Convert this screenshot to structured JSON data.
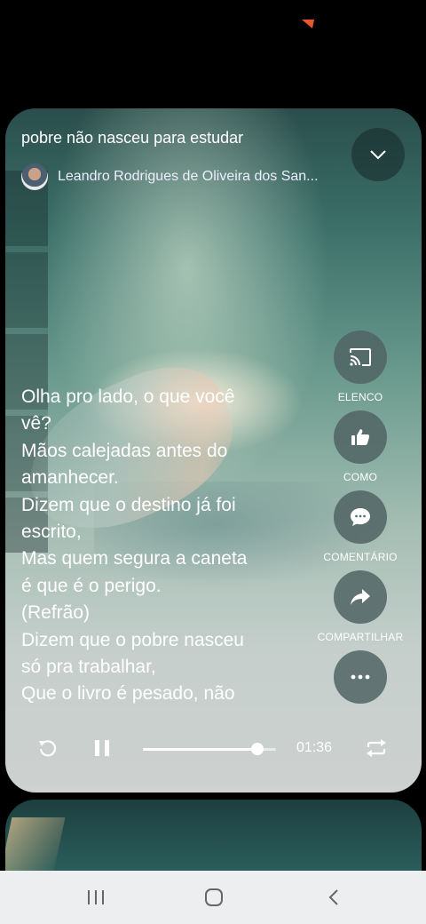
{
  "app": {
    "song_title": "pobre não nasceu para estudar",
    "author_name": "Leandro Rodrigues de Oliveira dos San..."
  },
  "lyrics": "Olha pro lado, o que você\nvê?\nMãos calejadas antes do\namanhecer.\nDizem que o destino já foi\nescrito,\nMas quem segura a caneta\né que é o perigo.\n(Refrão)\nDizem que o pobre nasceu\nsó pra trabalhar,\nQue o livro é pesado, não",
  "actions": [
    {
      "label": "ELENCO",
      "icon": "cast-icon"
    },
    {
      "label": "COMO",
      "icon": "thumbs-up-icon"
    },
    {
      "label": "COMENTÁRIO",
      "icon": "comment-icon"
    },
    {
      "label": "COMPARTILHAR",
      "icon": "share-icon"
    },
    {
      "label": "",
      "icon": "more-icon"
    }
  ],
  "player": {
    "time": "01:36",
    "progress": 0.86,
    "state": "playing"
  },
  "colors": {
    "accent_status": "#e8552e",
    "nav_bar": "#eceef0"
  }
}
